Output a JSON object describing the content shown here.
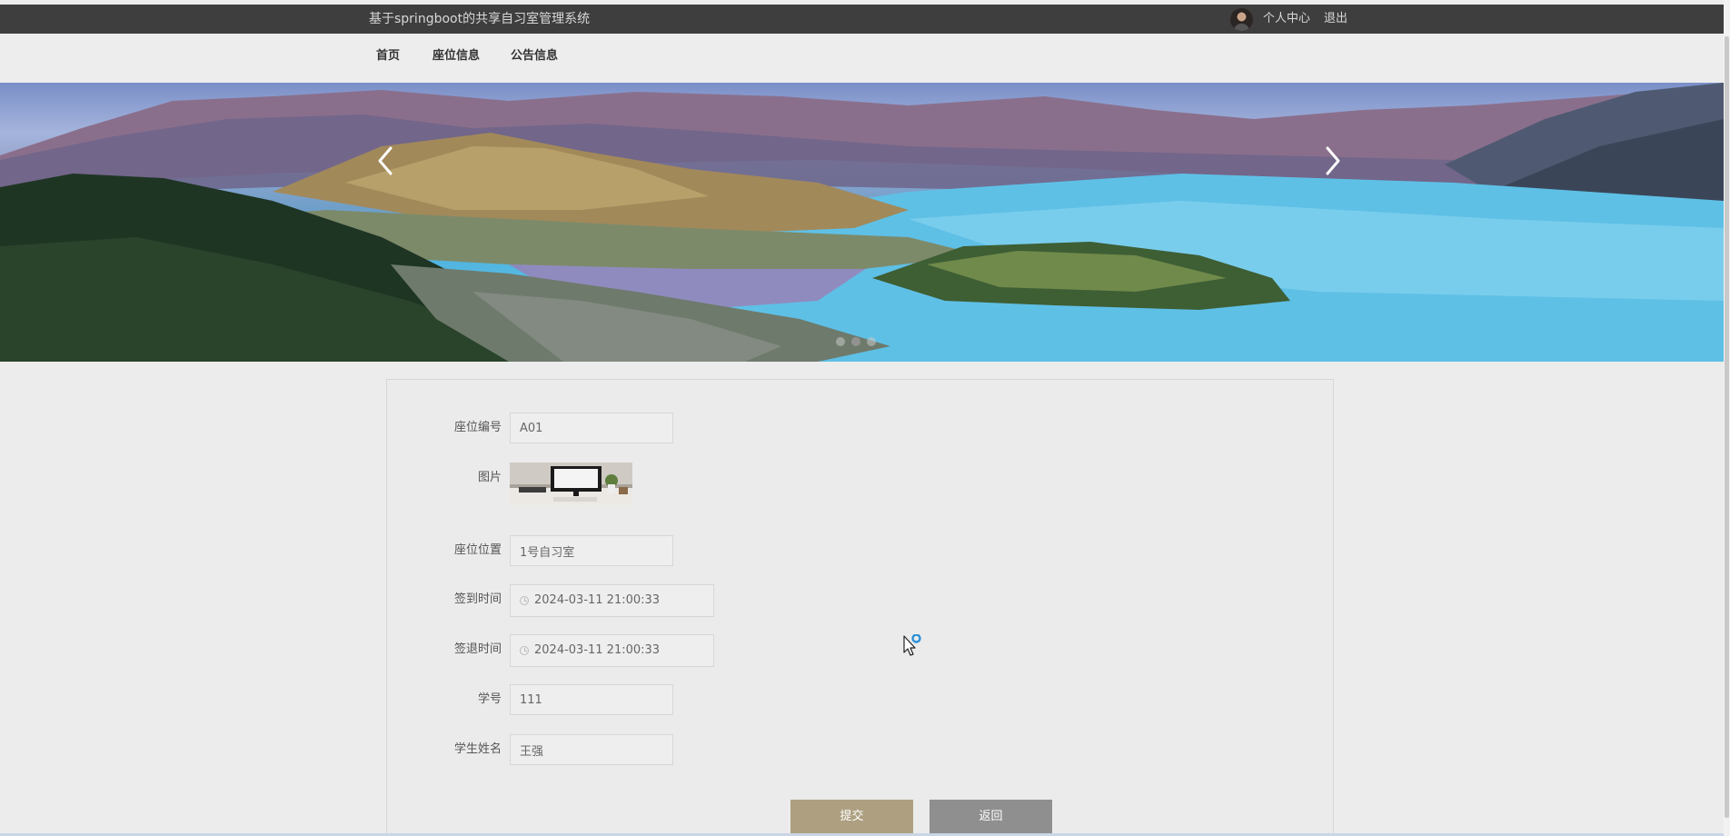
{
  "header": {
    "site_title": "基于springboot的共享自习室管理系统",
    "personal_center": "个人中心",
    "logout": "退出"
  },
  "nav": {
    "items": [
      {
        "label": "首页"
      },
      {
        "label": "座位信息"
      },
      {
        "label": "公告信息"
      }
    ]
  },
  "banner": {
    "slide_count": 3,
    "active_slide": 2,
    "image_description_icon": "landscape-photo"
  },
  "form": {
    "seat_number": {
      "label": "座位编号",
      "value": "A01"
    },
    "image": {
      "label": "图片"
    },
    "seat_location": {
      "label": "座位位置",
      "value": "1号自习室"
    },
    "checkin_time": {
      "label": "签到时间",
      "value": "2024-03-11 21:00:33"
    },
    "checkout_time": {
      "label": "签退时间",
      "value": "2024-03-11 21:00:33"
    },
    "student_id": {
      "label": "学号",
      "value": "111"
    },
    "student_name": {
      "label": "学生姓名",
      "value": "王强"
    },
    "submit_label": "提交",
    "back_label": "返回"
  },
  "colors": {
    "topbar": "#3e3e3e",
    "submit_button": "#ad9f80",
    "back_button": "#8f8f8f",
    "page_background": "#ececec"
  }
}
